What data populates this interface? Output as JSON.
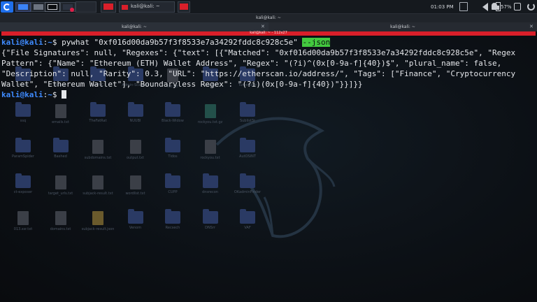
{
  "taskbar": {
    "task_title": "kali@kali: ~",
    "clock": "01:03 PM",
    "battery_percent": "57%"
  },
  "window": {
    "title": "kali@kali: ~",
    "tabs": [
      {
        "label": "kali@kali: ~"
      },
      {
        "label": "kali@kali: ~"
      }
    ],
    "size_bar": "kali@kali: ~ - 112x27",
    "close_glyph": "✕"
  },
  "terminal": {
    "prompt_user": "kali@kali",
    "prompt_sep": ":",
    "prompt_path": "~",
    "prompt_sym": "$ ",
    "command": "pywhat \"0xf016d00da9b57f3f8533e7a34292fddc8c928c5e\" ",
    "selected_arg": "--json",
    "output": [
      "{\"File Signatures\": null, \"Regexes\": {\"text\": [{\"Matched\": \"0xf016d00da9b57f3f8533e7a34292fddc8c928c5e\", \"Regex",
      "Pattern\": {\"Name\": \"Ethereum (ETH) Wallet Address\", \"Regex\": \"(?i)^(0x[0-9a-f]{40})$\", \"plural_name\": false,",
      "\"Description\": null, \"Rarity\": 0.3, \"URL\": \"https://etherscan.io/address/\", \"Tags\": [\"Finance\", \"Cryptocurrency",
      "Wallet\", \"Ethereum Wallet\"], \"Boundaryless Regex\": \"(?i)(0x[0-9a-f]{40})\"}}]}}"
    ]
  },
  "desktop": {
    "icons": [
      {
        "label": "Home",
        "kind": "folder"
      },
      {
        "label": "Builder",
        "kind": "folder"
      },
      {
        "label": "noVNC",
        "kind": "folder"
      },
      {
        "label": "Admin-Scanner",
        "kind": "folder"
      },
      {
        "label": "list.txt",
        "kind": "file"
      },
      {
        "label": "Spoofer",
        "kind": "folder"
      },
      {
        "label": "Turbolist3r",
        "kind": "folder"
      },
      {
        "label": "ssq",
        "kind": "folder"
      },
      {
        "label": "emails.txt",
        "kind": "file"
      },
      {
        "label": "TheFatRat",
        "kind": "folder"
      },
      {
        "label": "NUUBI",
        "kind": "folder"
      },
      {
        "label": "Black-Widow",
        "kind": "folder"
      },
      {
        "label": "rockyou.txt.gz",
        "kind": "gz"
      },
      {
        "label": "Sublist3r",
        "kind": "folder"
      },
      {
        "label": "ParamSpider",
        "kind": "folder"
      },
      {
        "label": "Bashed",
        "kind": "folder"
      },
      {
        "label": "subdomains.txt",
        "kind": "file"
      },
      {
        "label": "output.txt",
        "kind": "file"
      },
      {
        "label": "Tidos",
        "kind": "folder"
      },
      {
        "label": "rockyou.txt",
        "kind": "file"
      },
      {
        "label": "AutOSINT",
        "kind": "folder"
      },
      {
        "label": "ct-exposer",
        "kind": "folder"
      },
      {
        "label": "target_urls.txt",
        "kind": "file"
      },
      {
        "label": "subjack-result.txt",
        "kind": "file"
      },
      {
        "label": "wordlist.txt",
        "kind": "file"
      },
      {
        "label": "CUPP",
        "kind": "folder"
      },
      {
        "label": "dnsrecon",
        "kind": "folder"
      },
      {
        "label": "OKadminFinder",
        "kind": "folder"
      },
      {
        "label": "013.ssr.txt",
        "kind": "file"
      },
      {
        "label": "domains.txt",
        "kind": "file"
      },
      {
        "label": "subjack-result.json",
        "kind": "yellow"
      },
      {
        "label": "Venom",
        "kind": "folder"
      },
      {
        "label": "Recsech",
        "kind": "folder"
      },
      {
        "label": "DNSrr",
        "kind": "folder"
      },
      {
        "label": "VAF",
        "kind": "folder"
      }
    ]
  }
}
